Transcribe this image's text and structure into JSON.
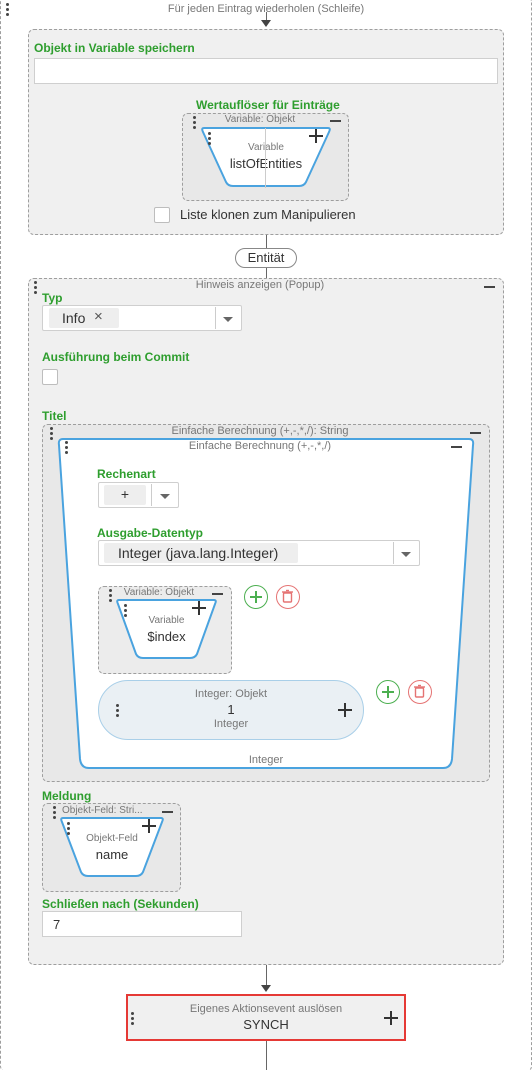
{
  "loop": {
    "title": "Für jeden Eintrag wiederholen (Schleife)"
  },
  "store": {
    "label": "Objekt in Variable speichern",
    "input_value": "",
    "resolver_label": "Wertauflöser für Einträge",
    "variable_caption": "Variable: Objekt",
    "node_type": "Variable",
    "node_value": "listOfEntities",
    "clone_label": "Liste klonen zum Manipulieren"
  },
  "entity_tag": "Entität",
  "popup": {
    "title": "Hinweis anzeigen (Popup)",
    "type_label": "Typ",
    "type_chip": "Info",
    "chip_remove": "×",
    "commit_label": "Ausführung beim Commit",
    "title_label": "Titel",
    "calc_outer": "Einfache Berechnung (+,-,*,/): String",
    "calc_inner": "Einfache Berechnung (+,-,*,/)",
    "op_label": "Rechenart",
    "op_value": "+",
    "out_label": "Ausgabe-Datentyp",
    "out_value": "Integer (java.lang.Integer)",
    "var_caption": "Variable: Objekt",
    "var_type": "Variable",
    "var_value": "$index",
    "int_caption": "Integer: Objekt",
    "int_value": "1",
    "int_sub": "Integer",
    "calc_footer": "Integer",
    "msg_label": "Meldung",
    "field_caption": "Objekt-Feld: Stri...",
    "field_type": "Objekt-Feld",
    "field_value": "name",
    "close_label": "Schließen nach (Sekunden)",
    "close_value": "7"
  },
  "action": {
    "caption": "Eigenes Aktionsevent auslösen",
    "value": "SYNCH"
  },
  "colors": {
    "green": "#2e9e2e",
    "blue_node": "#4aa3df",
    "red_highlight": "#e53935",
    "add_green": "#4caf50",
    "delete_red": "#e57373"
  }
}
